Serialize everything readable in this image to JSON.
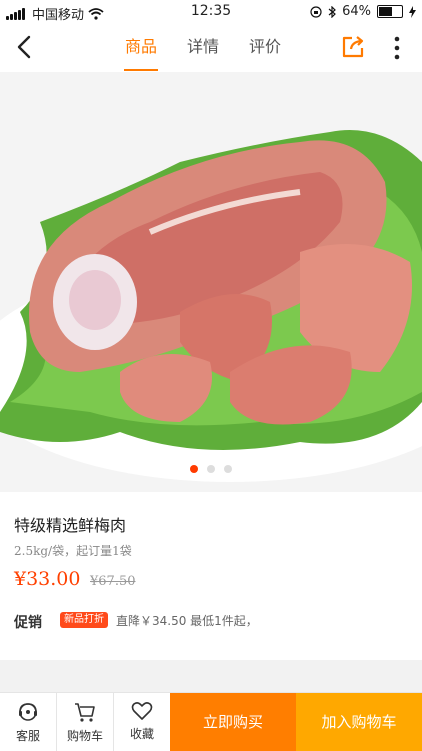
{
  "status_bar": {
    "carrier": "中国移动",
    "time": "12:35",
    "battery": "64%",
    "battery_level": 0.64,
    "icons": [
      "signal-icon",
      "wifi-icon",
      "lock-rotation-icon",
      "bluetooth-icon",
      "battery-icon",
      "charging-icon"
    ]
  },
  "nav": {
    "tabs": [
      {
        "label": "商品",
        "active": true
      },
      {
        "label": "详情",
        "active": false
      },
      {
        "label": "评价",
        "active": false
      }
    ],
    "icons": [
      "back-icon",
      "share-icon",
      "more-icon"
    ]
  },
  "gallery": {
    "image": "product-meat-photo",
    "dots": 3,
    "active_index": 0
  },
  "product": {
    "title": "特级精选鲜梅肉",
    "spec": "2.5kg/袋，起订量1袋",
    "price": "¥33.00",
    "original_price": "¥67.50",
    "promo_label": "促销",
    "promo_badge": "新品打折",
    "promo_text": "直降￥34.50 最低1件起，"
  },
  "bottom_bar": {
    "service": "客服",
    "cart": "购物车",
    "favorite": "收藏",
    "buy_now": "立即购买",
    "add_to_cart": "加入购物车"
  },
  "colors": {
    "accent": "#ff7a00",
    "price": "#ff4000",
    "buy_now_bg": "#ff7e00",
    "add_to_cart_bg": "#ffa800",
    "badge_bg": "#ff4a1a"
  }
}
